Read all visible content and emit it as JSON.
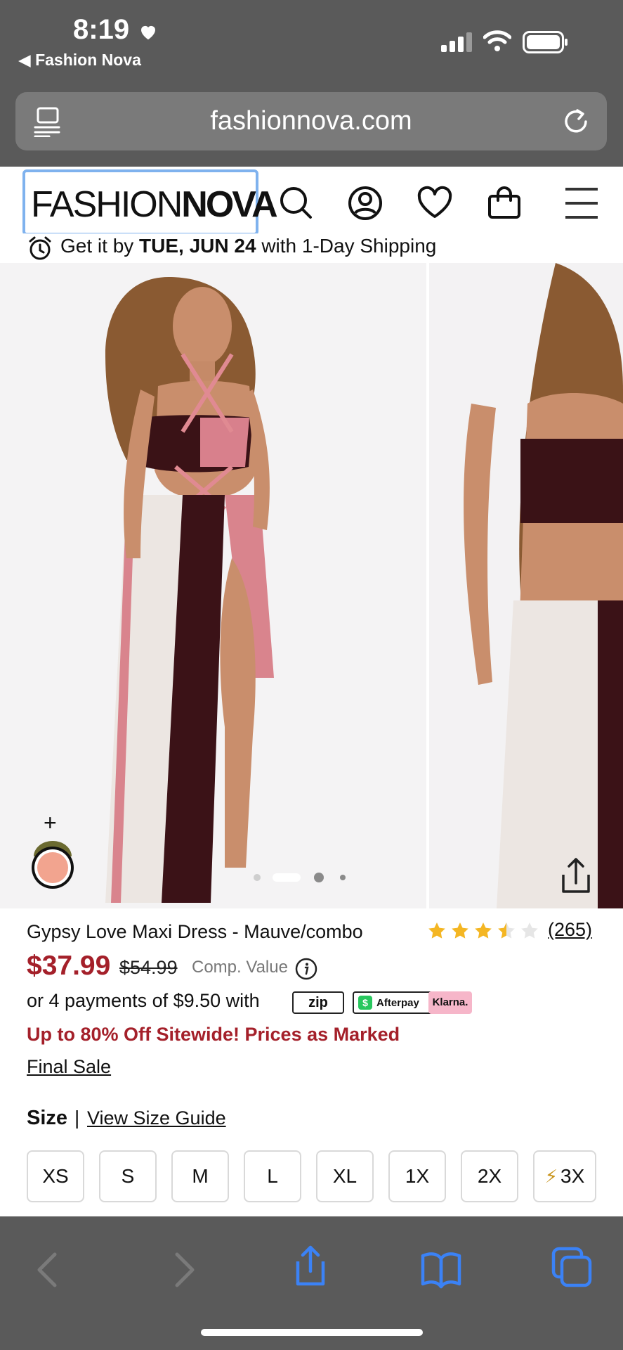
{
  "status_bar": {
    "time": "8:19",
    "back_app": "◀ Fashion Nova"
  },
  "browser": {
    "url": "fashionnova.com"
  },
  "site": {
    "logo_light": "FASHION",
    "logo_bold": "NOVA",
    "shipping_prefix": "Get it by ",
    "shipping_date": "TUE, JUN 24",
    "shipping_suffix": " with 1-Day Shipping"
  },
  "gallery": {
    "plus": "+",
    "current_slide": 2,
    "slide_count": 4
  },
  "product": {
    "name": "Gypsy Love Maxi Dress - Mauve/combo",
    "rating": 3.5,
    "rating_max": 5,
    "review_count": "(265)",
    "price": "$37.99",
    "old_price": "$54.99",
    "comp_value": "Comp. Value",
    "payments_text": "or 4 payments of $9.50 with",
    "zip_label": "zip",
    "afterpay_label": "Afterpay",
    "klarna_label": "Klarna.",
    "promo": "Up to 80% Off Sitewide! Prices as Marked",
    "final_sale": "Final Sale"
  },
  "sizes": {
    "label": "Size",
    "separator": "|",
    "guide": "View Size Guide",
    "options": [
      "XS",
      "S",
      "M",
      "L",
      "XL",
      "1X",
      "2X",
      "3X"
    ]
  },
  "colors": {
    "price_red": "#a4202a",
    "browser_gray": "#5a5a5a",
    "safari_blue": "#3b82f6",
    "swatch": "#f2a48f"
  }
}
